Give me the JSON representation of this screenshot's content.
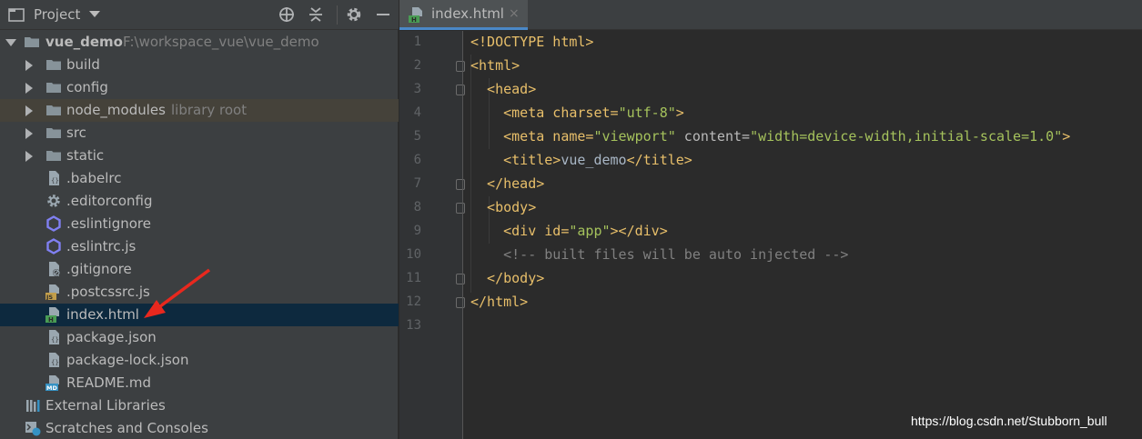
{
  "project_panel": {
    "title": "Project",
    "tree": [
      {
        "name": "vue_demo",
        "path": "F:\\workspace_vue\\vue_demo",
        "kind": "folder",
        "expanded": true,
        "level": 0
      },
      {
        "name": "build",
        "kind": "folder",
        "level": 1
      },
      {
        "name": "config",
        "kind": "folder",
        "level": 1
      },
      {
        "name": "node_modules",
        "hint": "library root",
        "kind": "folder",
        "level": 1
      },
      {
        "name": "src",
        "kind": "folder",
        "level": 1
      },
      {
        "name": "static",
        "kind": "folder",
        "level": 1
      },
      {
        "name": ".babelrc",
        "kind": "json-file",
        "level": 1
      },
      {
        "name": ".editorconfig",
        "kind": "config-file",
        "level": 1
      },
      {
        "name": ".eslintignore",
        "kind": "eslint-file",
        "level": 1
      },
      {
        "name": ".eslintrc.js",
        "kind": "eslint-file",
        "level": 1
      },
      {
        "name": ".gitignore",
        "kind": "ignore-file",
        "level": 1
      },
      {
        "name": ".postcssrc.js",
        "kind": "js-file",
        "level": 1
      },
      {
        "name": "index.html",
        "kind": "html-file",
        "level": 1,
        "selected": true
      },
      {
        "name": "package.json",
        "kind": "json-file",
        "level": 1
      },
      {
        "name": "package-lock.json",
        "kind": "json-file",
        "level": 1
      },
      {
        "name": "README.md",
        "kind": "md-file",
        "level": 1
      },
      {
        "name": "External Libraries",
        "kind": "libraries",
        "level": 0
      },
      {
        "name": "Scratches and Consoles",
        "kind": "scratches",
        "level": 0
      }
    ]
  },
  "editor": {
    "tab": {
      "label": "index.html",
      "close": "×"
    },
    "line_numbers": [
      "1",
      "2",
      "3",
      "4",
      "5",
      "6",
      "7",
      "8",
      "9",
      "10",
      "11",
      "12",
      "13"
    ],
    "lines": [
      {
        "a": "<!DOCTYPE html>"
      },
      {
        "a": "<html>"
      },
      {
        "a": "  <head>"
      },
      {
        "a": "    <meta charset=",
        "b": "\"utf-8\"",
        "c": ">"
      },
      {
        "a": "    <meta name=",
        "b": "\"viewport\"",
        "c": " content=",
        "d": "\"width=device-width,initial-scale=1.0\"",
        "e": ">"
      },
      {
        "a": "    <title>",
        "b": "vue_demo",
        "c": "</title>"
      },
      {
        "a": "  </head>"
      },
      {
        "a": "  <body>"
      },
      {
        "a": "    <div id=",
        "b": "\"app\"",
        "c": "></div>"
      },
      {
        "a": "    <!-- built files will be auto injected -->"
      },
      {
        "a": "  </body>"
      },
      {
        "a": "</html>"
      },
      {
        "a": ""
      }
    ]
  },
  "watermark": "https://blog.csdn.net/Stubborn_bull",
  "colors": {
    "selection": "#0d293e",
    "tab_accent": "#4a88c7",
    "annotation_arrow": "#e8281e"
  }
}
